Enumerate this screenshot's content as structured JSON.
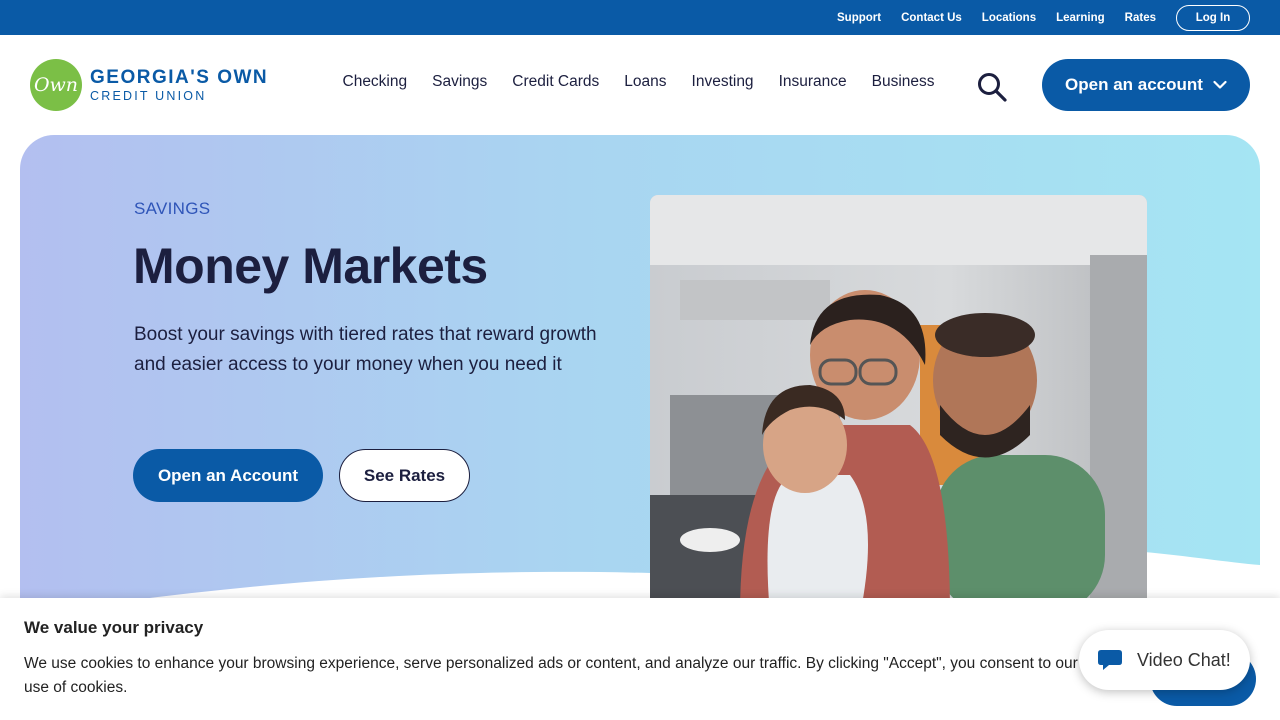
{
  "utility_nav": {
    "links": [
      "Support",
      "Contact Us",
      "Locations",
      "Learning",
      "Rates"
    ],
    "login_label": "Log In"
  },
  "logo": {
    "mark": "Own",
    "line1": "GEORGIA'S OWN",
    "line2": "CREDIT UNION"
  },
  "main_nav": {
    "items": [
      "Checking",
      "Savings",
      "Credit Cards",
      "Loans",
      "Investing",
      "Insurance",
      "Business"
    ],
    "search_icon": "search-icon",
    "cta_label": "Open an account"
  },
  "hero": {
    "eyebrow": "SAVINGS",
    "title": "Money Markets",
    "description": "Boost your savings with tiered rates that reward growth and easier access to your money when you need it",
    "primary_button": "Open an Account",
    "secondary_button": "See Rates"
  },
  "cookie_banner": {
    "title": "We value your privacy",
    "text": "We use cookies to enhance your browsing experience, serve personalized ads or content, and analyze our traffic. By clicking \"Accept\", you consent to our use of cookies."
  },
  "video_chat": {
    "label": "Video Chat!"
  },
  "colors": {
    "brand_blue": "#0a5aa6",
    "logo_green": "#7bbf46",
    "text_dark": "#1c1f3f"
  }
}
